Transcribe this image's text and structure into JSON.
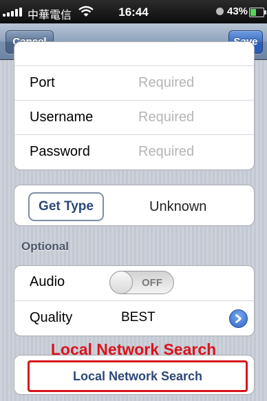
{
  "status_bar": {
    "carrier": "中華電信",
    "time": "16:44",
    "battery_percent": "43%",
    "battery_level": 0.43
  },
  "nav": {
    "cancel_label": "Cancel",
    "save_label": "Save"
  },
  "connection": {
    "rows": [
      {
        "label": "Port",
        "placeholder": "Required"
      },
      {
        "label": "Username",
        "placeholder": "Required"
      },
      {
        "label": "Password",
        "placeholder": "Required"
      }
    ]
  },
  "type": {
    "button_label": "Get Type",
    "value": "Unknown"
  },
  "optional": {
    "header": "Optional",
    "audio_label": "Audio",
    "audio_state": "OFF",
    "quality_label": "Quality",
    "quality_value": "BEST"
  },
  "annotation_text": "Local Network Search",
  "search_button_label": "Local Network Search",
  "colors": {
    "annotation": "#d9141b",
    "button_text": "#2d4876",
    "nav_tint": "#6d84a3"
  }
}
